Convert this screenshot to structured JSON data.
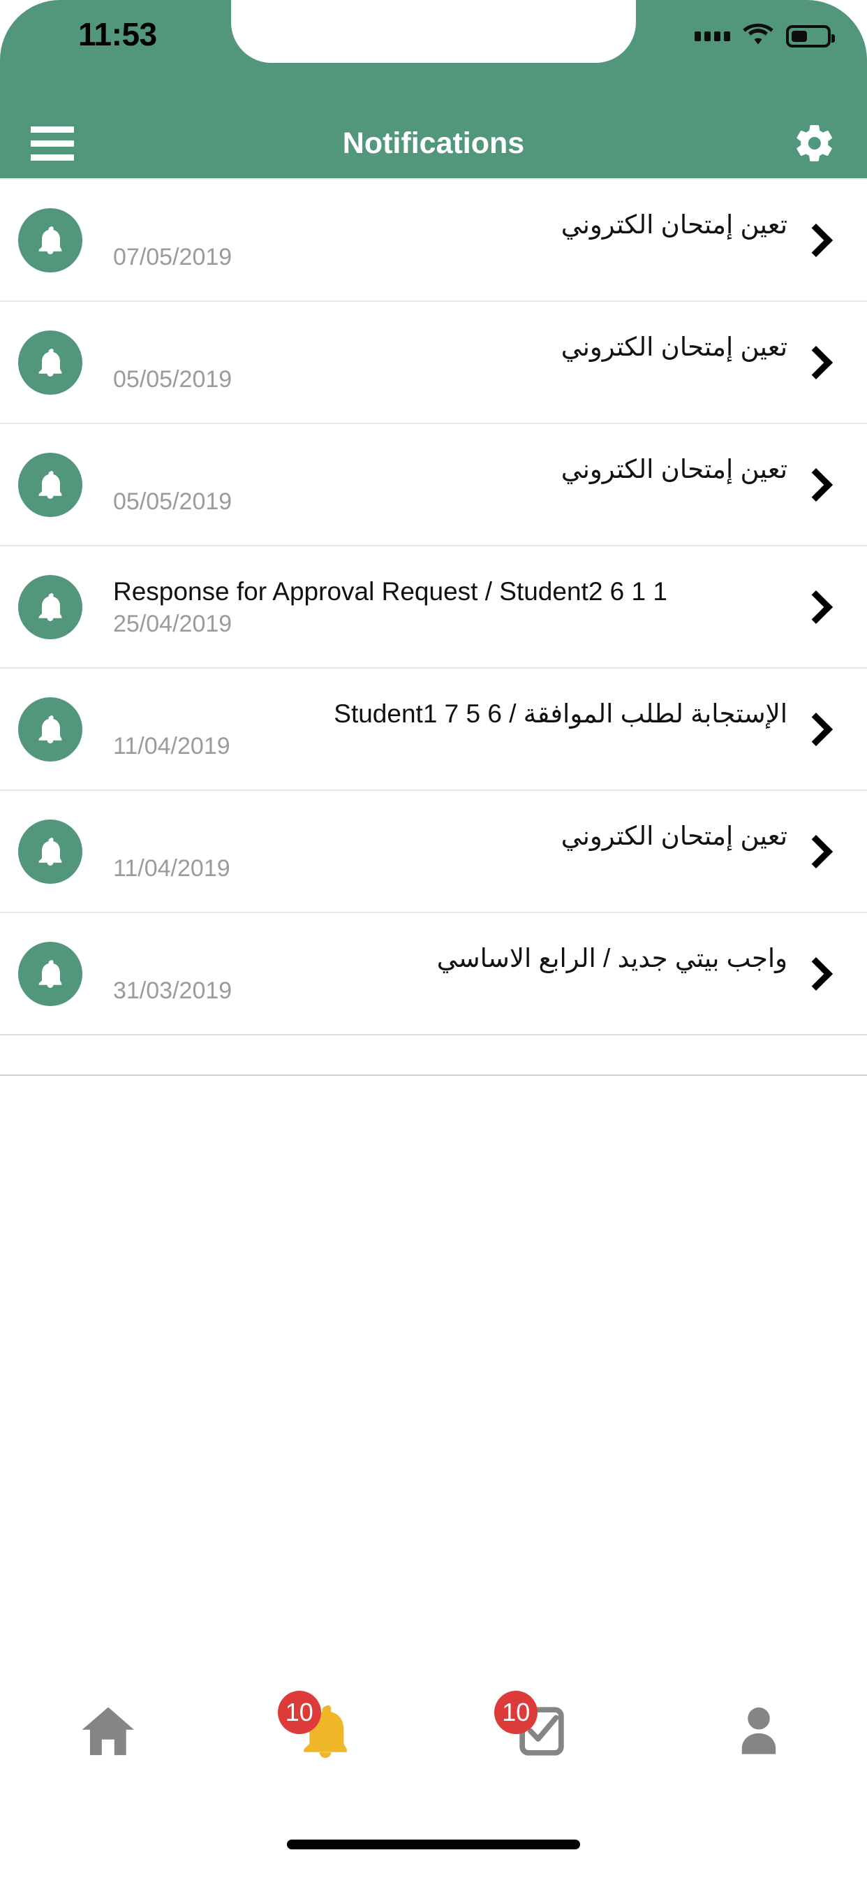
{
  "status_bar": {
    "time": "11:53",
    "signal_icon": "signal-dots-icon",
    "wifi_icon": "wifi-icon",
    "battery_icon": "battery-icon"
  },
  "nav_bar": {
    "menu_icon": "hamburger-menu-icon",
    "title": "Notifications",
    "settings_icon": "gear-icon"
  },
  "theme": {
    "primary_green": "#52967B",
    "badge_red": "#DC3B39",
    "active_tab_amber": "#EFB728",
    "inactive_tab_gray": "#858585",
    "date_gray": "#9b9b9b"
  },
  "notifications": [
    {
      "icon": "bell-icon",
      "title": "تعين إمتحان الكتروني",
      "date": "07/05/2019",
      "dir": "rtl",
      "chevron": "chevron-right-icon"
    },
    {
      "icon": "bell-icon",
      "title": "تعين إمتحان الكتروني",
      "date": "05/05/2019",
      "dir": "rtl",
      "chevron": "chevron-right-icon"
    },
    {
      "icon": "bell-icon",
      "title": "تعين إمتحان الكتروني",
      "date": "05/05/2019",
      "dir": "rtl",
      "chevron": "chevron-right-icon"
    },
    {
      "icon": "bell-icon",
      "title": "Response for Approval Request / Student2 6 1 1",
      "date": "25/04/2019",
      "dir": "ltr",
      "chevron": "chevron-right-icon"
    },
    {
      "icon": "bell-icon",
      "title": "الإستجابة لطلب الموافقة / Student1 7 5 6",
      "date": "11/04/2019",
      "dir": "rtl",
      "chevron": "chevron-right-icon"
    },
    {
      "icon": "bell-icon",
      "title": "تعين إمتحان الكتروني",
      "date": "11/04/2019",
      "dir": "rtl",
      "chevron": "chevron-right-icon"
    },
    {
      "icon": "bell-icon",
      "title": "واجب بيتي جديد / الرابع الاساسي",
      "date": "31/03/2019",
      "dir": "rtl",
      "chevron": "chevron-right-icon"
    }
  ],
  "tab_bar": {
    "tabs": [
      {
        "name": "home",
        "icon": "home-icon",
        "badge": null,
        "active": false
      },
      {
        "name": "notifications",
        "icon": "bell-icon",
        "badge": "10",
        "active": true
      },
      {
        "name": "messages",
        "icon": "mail-check-icon",
        "badge": "10",
        "active": false
      },
      {
        "name": "profile",
        "icon": "person-icon",
        "badge": null,
        "active": false
      }
    ]
  },
  "home_indicator": "home-indicator-bar"
}
